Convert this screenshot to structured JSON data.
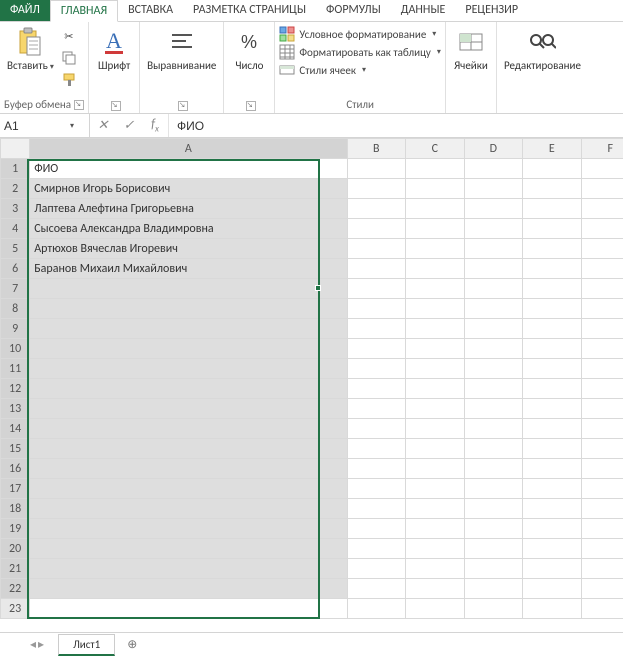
{
  "tabs": {
    "file": "ФАЙЛ",
    "home": "ГЛАВНАЯ",
    "insert": "ВСТАВКА",
    "pagelayout": "РАЗМЕТКА СТРАНИЦЫ",
    "formulas": "ФОРМУЛЫ",
    "data": "ДАННЫЕ",
    "review": "РЕЦЕНЗИР"
  },
  "ribbon": {
    "clipboard": {
      "paste": "Вставить",
      "group": "Буфер обмена"
    },
    "font": {
      "btn": "Шрифт",
      "group": ""
    },
    "alignment": {
      "btn": "Выравнивание",
      "group": ""
    },
    "number": {
      "btn": "Число",
      "group": ""
    },
    "styles": {
      "cond": "Условное форматирование",
      "table": "Форматировать как таблицу",
      "cell": "Стили ячеек",
      "group": "Стили"
    },
    "cells": {
      "btn": "Ячейки",
      "group": ""
    },
    "editing": {
      "btn": "Редактирование",
      "group": ""
    }
  },
  "namebox": {
    "value": "A1"
  },
  "formula": {
    "value": "ФИО"
  },
  "columns": [
    "A",
    "B",
    "C",
    "D",
    "E",
    "F"
  ],
  "rows": [
    "1",
    "2",
    "3",
    "4",
    "5",
    "6",
    "7",
    "8",
    "9",
    "10",
    "11",
    "12",
    "13",
    "14",
    "15",
    "16",
    "17",
    "18",
    "19",
    "20",
    "21",
    "22",
    "23"
  ],
  "cells": {
    "A1": "ФИО",
    "A2": "Смирнов Игорь Борисович",
    "A3": "Лаптева Алефтина Григорьевна",
    "A4": "Сысоева Александра Владимровна",
    "A5": "Артюхов Вячеслав Игоревич",
    "A6": "Баранов Михаил Михайлович"
  },
  "sheet": {
    "active": "Лист1"
  },
  "colors": {
    "accent": "#217346"
  }
}
